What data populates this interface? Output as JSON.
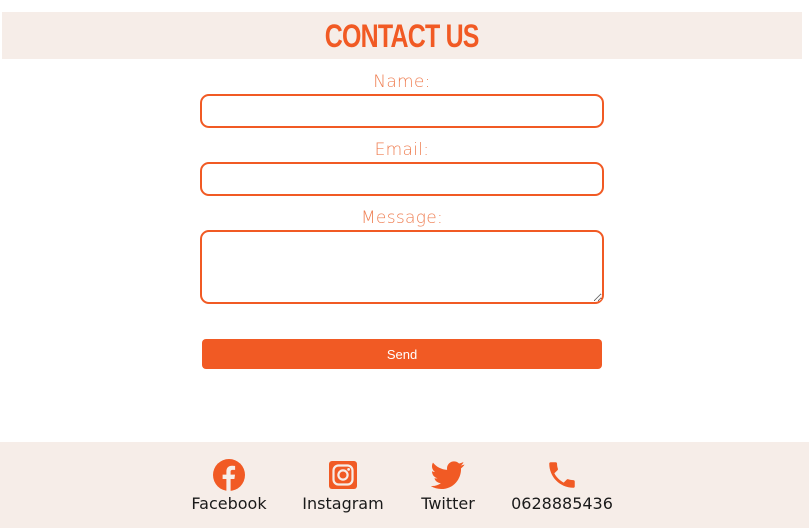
{
  "header": {
    "title": "Contact Us"
  },
  "form": {
    "name_label": "Name:",
    "name_value": "",
    "email_label": "Email:",
    "email_value": "",
    "message_label": "Message:",
    "message_value": "",
    "send_label": "Send"
  },
  "footer": {
    "facebook_label": "Facebook",
    "instagram_label": "Instagram",
    "twitter_label": "Twitter",
    "phone_label": "0628885436"
  },
  "colors": {
    "accent": "#f15a24",
    "label": "#ef7f53",
    "band_background": "#f6ede8",
    "footer_text": "#1a1a1a"
  },
  "icons": [
    "facebook-icon",
    "instagram-icon",
    "twitter-icon",
    "phone-icon"
  ]
}
